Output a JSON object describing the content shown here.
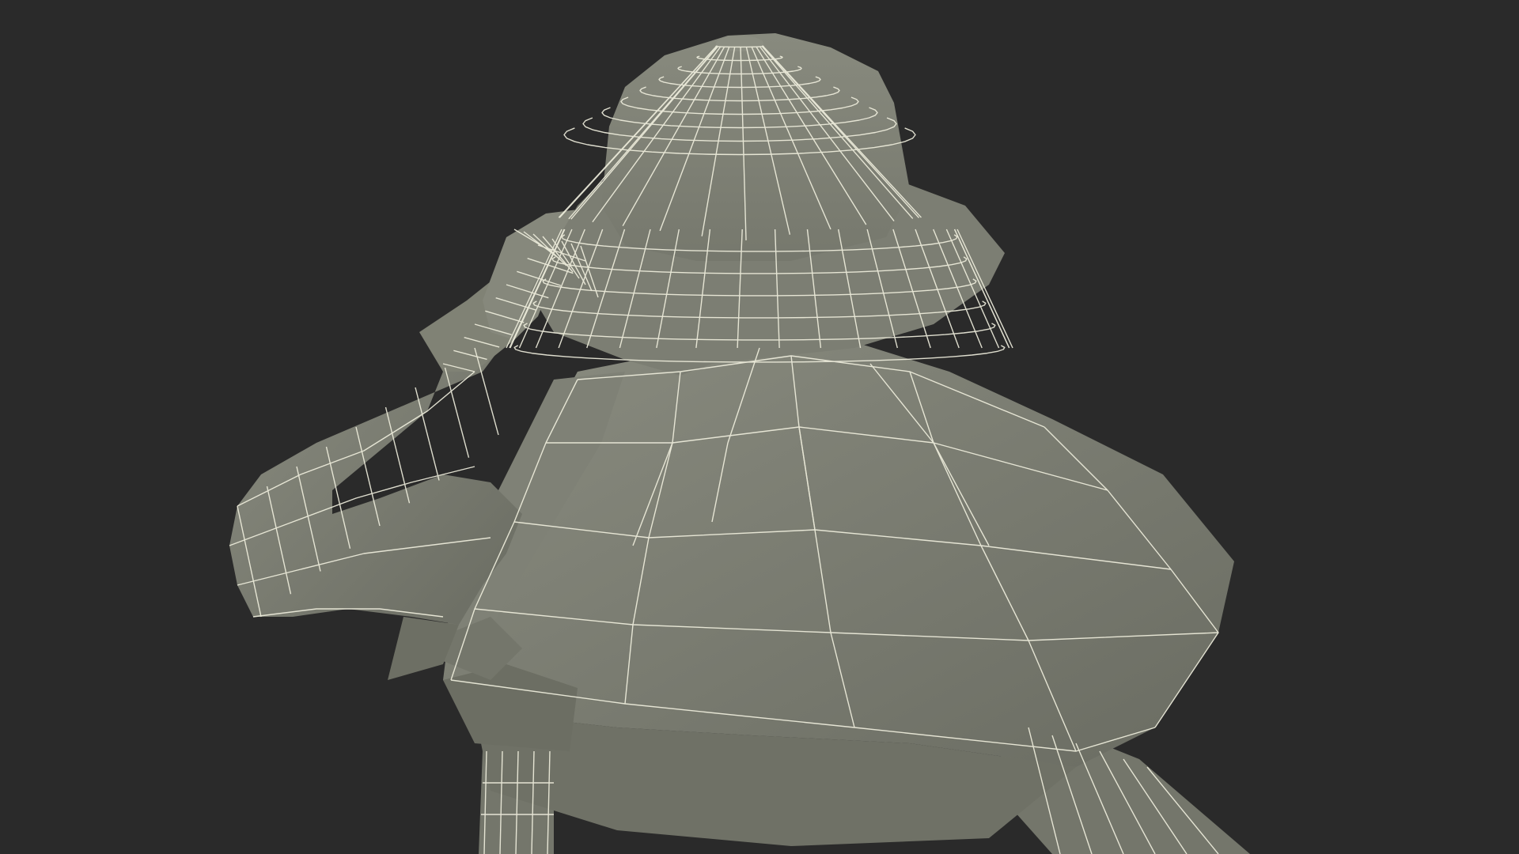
{
  "viewport": {
    "background": "#2a2a2a"
  },
  "model": {
    "subject": "wireframe-figure-with-bucket-hat",
    "surface_color": "#7b7d72",
    "surface_shadow": "#6a6c62",
    "surface_light": "#8a8c80",
    "wire_color": "#efeedd"
  }
}
